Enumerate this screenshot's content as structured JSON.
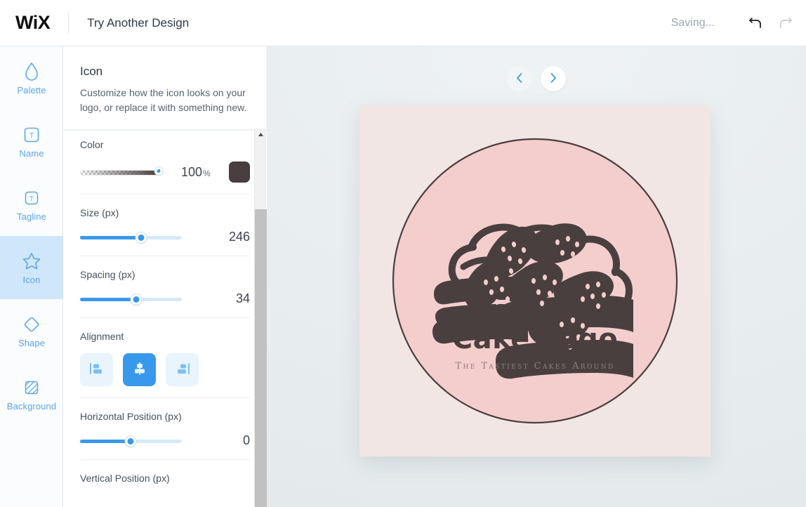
{
  "topbar": {
    "brand": "WiX",
    "title": "Try Another Design",
    "status": "Saving...",
    "undo_icon": "undo-arrow-icon",
    "redo_icon": "redo-arrow-icon"
  },
  "sidebar": {
    "items": [
      {
        "label": "Palette",
        "icon": "droplet-icon",
        "active": false
      },
      {
        "label": "Name",
        "icon": "text-box-icon",
        "active": false
      },
      {
        "label": "Tagline",
        "icon": "text-box-icon",
        "active": false
      },
      {
        "label": "Icon",
        "icon": "star-icon",
        "active": true
      },
      {
        "label": "Shape",
        "icon": "diamond-icon",
        "active": false
      },
      {
        "label": "Background",
        "icon": "hatched-square-icon",
        "active": false
      }
    ]
  },
  "panel": {
    "title": "Icon",
    "description": "Customize how the icon looks on your logo, or replace it with something new.",
    "controls": {
      "color": {
        "label": "Color",
        "opacity_value": "100",
        "opacity_unit": "%",
        "opacity_percent": 100,
        "swatch_color": "#4a3f3f"
      },
      "size": {
        "label": "Size (px)",
        "value": "246",
        "percent": 60
      },
      "spacing": {
        "label": "Spacing (px)",
        "value": "34",
        "percent": 55
      },
      "alignment": {
        "label": "Alignment",
        "options": [
          {
            "name": "align-left",
            "selected": false
          },
          {
            "name": "align-center",
            "selected": true
          },
          {
            "name": "align-right",
            "selected": false
          }
        ]
      },
      "horizontal_position": {
        "label": "Horizontal Position (px)",
        "value": "0",
        "percent": 50
      },
      "vertical_position": {
        "label": "Vertical Position (px)"
      }
    }
  },
  "stage": {
    "prev_label": "‹",
    "next_label": "›",
    "logo": {
      "name": "Cake Logo",
      "tagline": "The Tastiest Cakes Around",
      "card_background": "#f2e6e4",
      "circle_background": "#f4cdcd",
      "ink_color": "#4a3f3f"
    }
  }
}
